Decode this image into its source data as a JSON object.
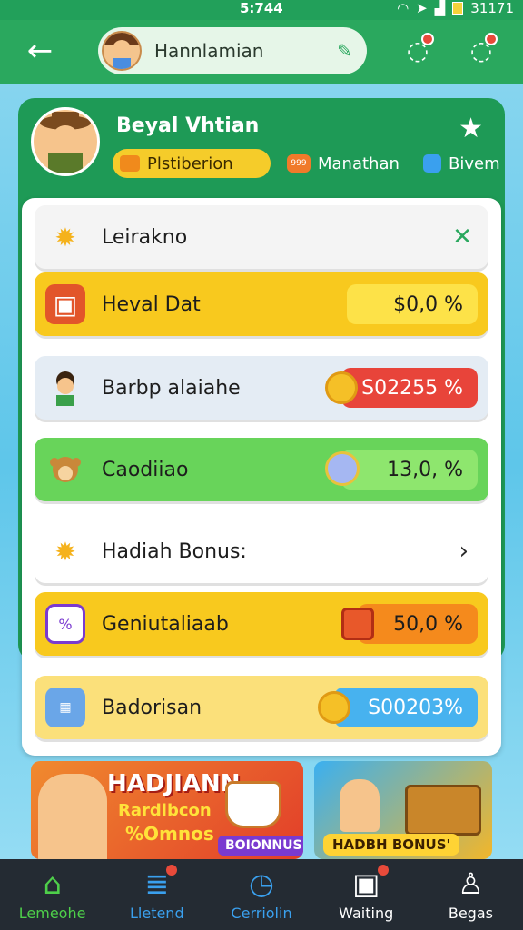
{
  "status_bar": {
    "time": "5:744",
    "battery": "31171"
  },
  "header": {
    "username": "Hannlamian"
  },
  "profile": {
    "name": "Beyal Vhtian",
    "badges": [
      {
        "label": "Plstiberion"
      },
      {
        "label": "Manathan",
        "icon_text": "999"
      },
      {
        "label": "Bivem"
      }
    ]
  },
  "rows": [
    {
      "label": "Leirakno",
      "icon": "sun-icon",
      "action": "close"
    },
    {
      "label": "Heval Dat",
      "value": "$0,0 %",
      "accent": "#f5c81c"
    },
    {
      "label": "Barbp alaiahe",
      "value": "S02255 %",
      "accent": "#e8443a"
    },
    {
      "label": "Caodiiao",
      "value": "13,0, %",
      "accent": "#5ccf4f"
    },
    {
      "label": "Hadiah Bonus:",
      "action": "chevron"
    },
    {
      "label": "Geniutaliaab",
      "value": "50,0 %",
      "accent": "#f07a1c"
    },
    {
      "label": "Badorisan",
      "value": "S00203%",
      "accent": "#47b2ef"
    }
  ],
  "banners": {
    "left": {
      "title": "HADJIANN",
      "line1": "Rardibcon",
      "line2": "%Omnos",
      "tag": "BOIONNUS"
    },
    "right": {
      "tag": "HADBH BONUS'"
    }
  },
  "nav": [
    {
      "label": "Lemeohe",
      "icon": "home-icon",
      "active": true
    },
    {
      "label": "Lletend",
      "icon": "list-icon"
    },
    {
      "label": "Cerriolin",
      "icon": "clock-icon"
    },
    {
      "label": "Waiting",
      "icon": "wallet-icon"
    },
    {
      "label": "Begas",
      "icon": "user-icon"
    }
  ]
}
